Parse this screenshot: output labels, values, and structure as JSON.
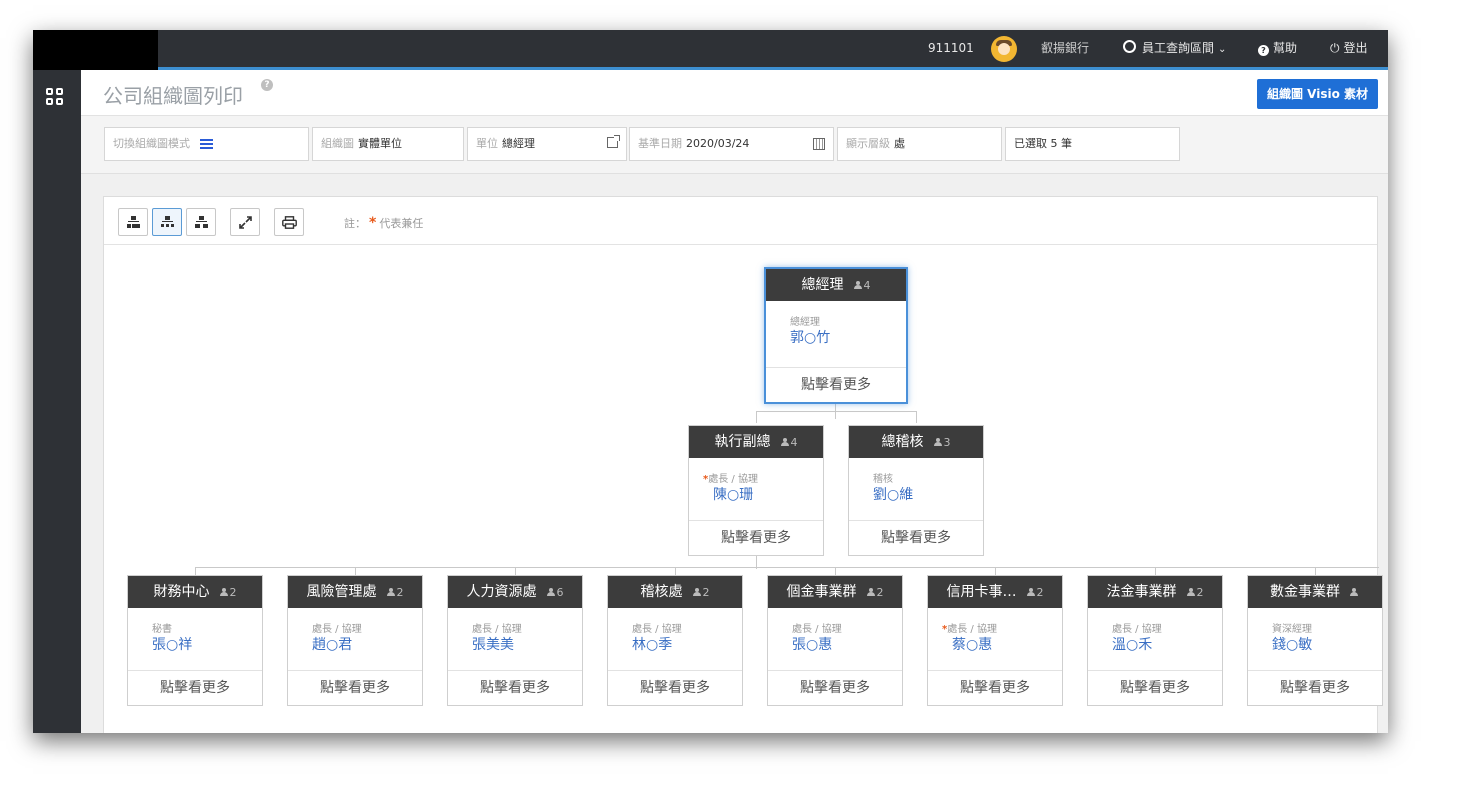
{
  "topbar": {
    "user_id": "911101",
    "bank": "叡揚銀行",
    "search_label": "員工查詢區間",
    "help_label": "幫助",
    "logout_label": "登出"
  },
  "header": {
    "title": "公司組織圖列印",
    "visio_button": "組織圖 Visio 素材"
  },
  "filters": {
    "mode_label": "切換組織圖模式",
    "chart_label": "組織圖",
    "chart_value": "實體單位",
    "unit_label": "單位",
    "unit_value": "總經理",
    "date_label": "基準日期",
    "date_value": "2020/03/24",
    "level_label": "顯示層級",
    "level_value": "處",
    "selected": "已選取 5 筆"
  },
  "note": {
    "prefix": "註：",
    "star": "*",
    "text": "代表兼任"
  },
  "nodes": {
    "root": {
      "title": "總經理",
      "count": "4",
      "role": "總經理",
      "name": "郭○竹",
      "more": "點擊看更多"
    },
    "exec_vp": {
      "title": "執行副總",
      "count": "4",
      "role": "處長 / 協理",
      "name": "陳○珊",
      "more": "點擊看更多"
    },
    "audit_chief": {
      "title": "總稽核",
      "count": "3",
      "role": "稽核",
      "name": "劉○維",
      "more": "點擊看更多"
    },
    "dept": [
      {
        "title": "財務中心",
        "count": "2",
        "role": "秘書",
        "name": "張○祥",
        "more": "點擊看更多",
        "star": ""
      },
      {
        "title": "風險管理處",
        "count": "2",
        "role": "處長 / 協理",
        "name": "趙○君",
        "more": "點擊看更多",
        "star": ""
      },
      {
        "title": "人力資源處",
        "count": "6",
        "role": "處長 / 協理",
        "name": "張美美",
        "more": "點擊看更多",
        "star": ""
      },
      {
        "title": "稽核處",
        "count": "2",
        "role": "處長 / 協理",
        "name": "林○季",
        "more": "點擊看更多",
        "star": ""
      },
      {
        "title": "個金事業群",
        "count": "2",
        "role": "處長 / 協理",
        "name": "張○惠",
        "more": "點擊看更多",
        "star": ""
      },
      {
        "title": "信用卡事…",
        "count": "2",
        "role": "處長 / 協理",
        "name": "蔡○惠",
        "more": "點擊看更多",
        "star": "*"
      },
      {
        "title": "法金事業群",
        "count": "2",
        "role": "處長 / 協理",
        "name": "溫○禾",
        "more": "點擊看更多",
        "star": ""
      },
      {
        "title": "數金事業群",
        "count": "",
        "role": "資深經理",
        "name": "錢○敏",
        "more": "點擊看更多",
        "star": ""
      }
    ]
  },
  "colors": {
    "accent": "#1f6fd6",
    "topbar": "#2e3136",
    "node_header": "#3c3c3c",
    "name_text": "#3a6fc4",
    "star": "#e8591a"
  }
}
